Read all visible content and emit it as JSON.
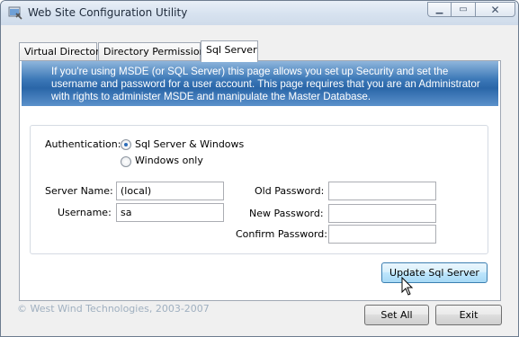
{
  "window": {
    "title": "Web Site Configuration Utility",
    "caption_buttons": {
      "minimize": "minimize",
      "maximize": "maximize",
      "close": "close"
    }
  },
  "tabs": [
    {
      "label": "Virtual Directory",
      "active": false
    },
    {
      "label": "Directory Permissions",
      "active": false
    },
    {
      "label": "Sql Server",
      "active": true
    }
  ],
  "banner": {
    "text": "If you're using MSDE (or SQL Server) this page allows you set up Security and set the username and password for a user account. This page requires that you are an Administrator with rights to administer MSDE and manipulate the Master Database."
  },
  "form": {
    "authentication_label": "Authentication:",
    "auth_options": [
      {
        "label": "Sql Server & Windows",
        "checked": true
      },
      {
        "label": "Windows only",
        "checked": false
      }
    ],
    "server_name_label": "Server Name:",
    "server_name_value": "(local)",
    "username_label": "Username:",
    "username_value": "sa",
    "old_password_label": "Old Password:",
    "old_password_value": "",
    "new_password_label": "New Password:",
    "new_password_value": "",
    "confirm_password_label": "Confirm Password:",
    "confirm_password_value": ""
  },
  "buttons": {
    "update_sql_server": "Update Sql Server",
    "set_all": "Set All",
    "exit": "Exit"
  },
  "footer": {
    "copyright": "© West Wind Technologies, 2003-2007"
  },
  "colors": {
    "banner_dark": "#2a66a8",
    "banner_light": "#8fb5dc",
    "copyright_text": "#a0b0c0",
    "button_hover_border": "#3c7fb1"
  }
}
